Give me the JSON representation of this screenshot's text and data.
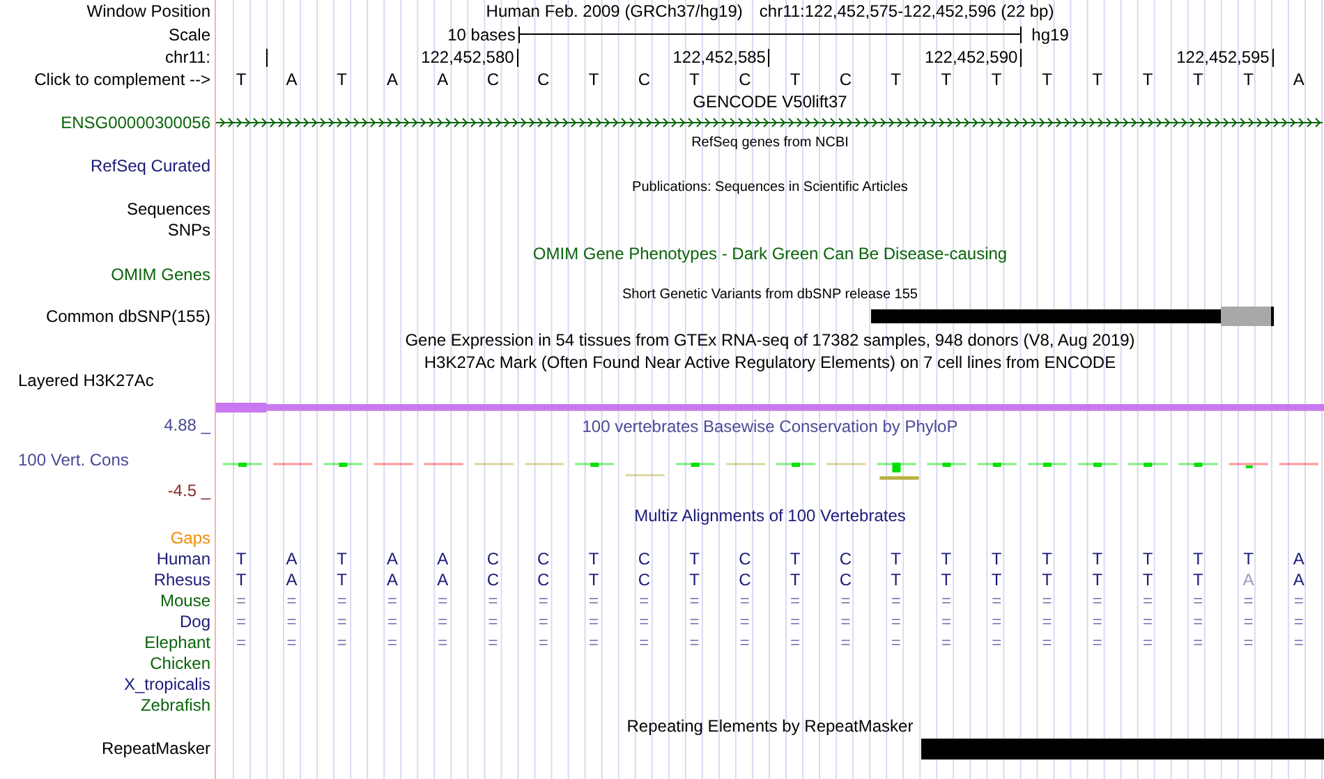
{
  "position_row": {
    "label": "Window Position",
    "assembly": "Human Feb. 2009 (GRCh37/hg19)",
    "range": "chr11:122,452,575-122,452,596 (22 bp)"
  },
  "scale_row": {
    "label": "Scale",
    "span": "10 bases",
    "assembly_tag": "hg19"
  },
  "ruler": {
    "label": "chr11:",
    "ticks": [
      "122,452,580",
      "122,452,585",
      "122,452,590",
      "122,452,595"
    ]
  },
  "sequence": {
    "label": "Click to complement -->",
    "bases": [
      "T",
      "A",
      "T",
      "A",
      "A",
      "C",
      "C",
      "T",
      "C",
      "T",
      "C",
      "T",
      "C",
      "T",
      "T",
      "T",
      "T",
      "T",
      "T",
      "T",
      "T",
      "A"
    ]
  },
  "gencode": {
    "title": "GENCODE V50lift37",
    "gene": "ENSG00000300056"
  },
  "refseq": {
    "title": "RefSeq genes from NCBI",
    "label": "RefSeq Curated"
  },
  "publications": {
    "title": "Publications: Sequences in Scientific Articles",
    "labels": [
      "Sequences",
      "SNPs"
    ]
  },
  "omim": {
    "title": "OMIM Gene Phenotypes - Dark Green Can Be Disease-causing",
    "label": "OMIM Genes"
  },
  "dbsnp": {
    "title": "Short Genetic Variants from dbSNP release 155",
    "label": "Common dbSNP(155)"
  },
  "gtex": {
    "title": "Gene Expression in 54 tissues from GTEx RNA-seq of 17382 samples, 948 donors (V8, Aug 2019)"
  },
  "h3k27ac": {
    "title": "H3K27Ac Mark (Often Found Near Active Regulatory Elements) on 7 cell lines from ENCODE",
    "label": "Layered H3K27Ac"
  },
  "conservation": {
    "title": "100 vertebrates Basewise Conservation by PhyloP",
    "label": "100 Vert. Cons",
    "max": "4.88 _",
    "min": "-4.5 _"
  },
  "multiz": {
    "title": "Multiz Alignments of 100 Vertebrates",
    "gaps_label": "Gaps",
    "species": [
      {
        "name": "Human",
        "color": "#1a1a78",
        "cells": [
          "T",
          "A",
          "T",
          "A",
          "A",
          "C",
          "C",
          "T",
          "C",
          "T",
          "C",
          "T",
          "C",
          "T",
          "T",
          "T",
          "T",
          "T",
          "T",
          "T",
          "T",
          "A"
        ]
      },
      {
        "name": "Rhesus",
        "color": "#1a1a78",
        "cells": [
          "T",
          "A",
          "T",
          "A",
          "A",
          "C",
          "C",
          "T",
          "C",
          "T",
          "C",
          "T",
          "C",
          "T",
          "T",
          "T",
          "T",
          "T",
          "T",
          "T",
          "A",
          "A"
        ],
        "mismatch": [
          false,
          false,
          false,
          false,
          false,
          false,
          false,
          false,
          false,
          false,
          false,
          false,
          false,
          false,
          false,
          false,
          false,
          false,
          false,
          false,
          true,
          false
        ]
      },
      {
        "name": "Mouse",
        "color": "#0a640a",
        "cells": [
          "=",
          "=",
          "=",
          "=",
          "=",
          "=",
          "=",
          "=",
          "=",
          "=",
          "=",
          "=",
          "=",
          "=",
          "=",
          "=",
          "=",
          "=",
          "=",
          "=",
          "=",
          "="
        ]
      },
      {
        "name": "Dog",
        "color": "#1a1a78",
        "cells": [
          "=",
          "=",
          "=",
          "=",
          "=",
          "=",
          "=",
          "=",
          "=",
          "=",
          "=",
          "=",
          "=",
          "=",
          "=",
          "=",
          "=",
          "=",
          "=",
          "=",
          "=",
          "="
        ]
      },
      {
        "name": "Elephant",
        "color": "#0a640a",
        "cells": [
          "=",
          "=",
          "=",
          "=",
          "=",
          "=",
          "=",
          "=",
          "=",
          "=",
          "=",
          "=",
          "=",
          "=",
          "=",
          "=",
          "=",
          "=",
          "=",
          "=",
          "=",
          "="
        ]
      },
      {
        "name": "Chicken",
        "color": "#0a640a"
      },
      {
        "name": "X_tropicalis",
        "color": "#1a1a78"
      },
      {
        "name": "Zebrafish",
        "color": "#0a640a"
      }
    ]
  },
  "repeatmasker": {
    "title": "Repeating Elements by RepeatMasker",
    "label": "RepeatMasker"
  }
}
